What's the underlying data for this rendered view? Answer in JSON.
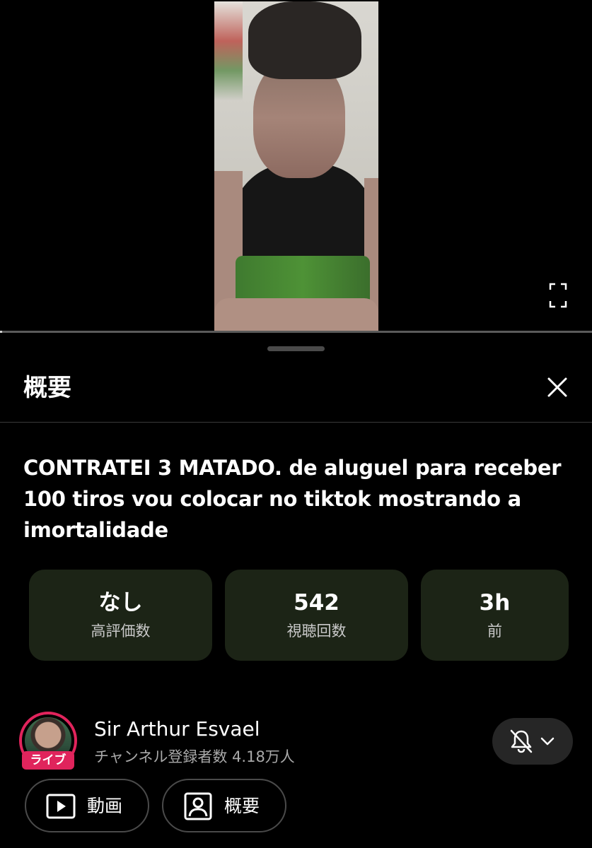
{
  "player": {
    "progress": 0.004
  },
  "panel": {
    "title": "概要",
    "video_title": "CONTRATEI 3 MATADO. de aluguel para receber 100 tiros vou colocar no tiktok mostrando a imortalidade"
  },
  "stats": [
    {
      "value": "なし",
      "label": "高評価数"
    },
    {
      "value": "542",
      "label": "視聴回数"
    },
    {
      "value": "3h",
      "label": "前"
    }
  ],
  "channel": {
    "live_badge": "ライブ",
    "name": "Sir Arthur Esvael",
    "subscribers": "チャンネル登録者数 4.18万人",
    "notification_icon": "bell-off-icon"
  },
  "buttons": {
    "videos": {
      "label": "動画",
      "icon": "play-icon"
    },
    "about": {
      "label": "概要",
      "icon": "person-icon"
    }
  },
  "colors": {
    "accent_live": "#e0245c",
    "stat_card_bg": "#1c2416"
  }
}
